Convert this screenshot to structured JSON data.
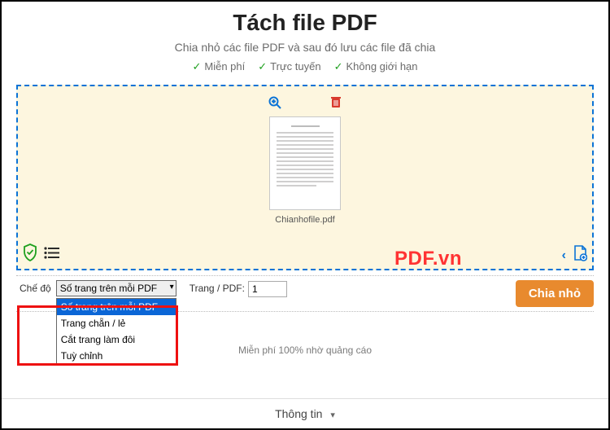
{
  "hero": {
    "title": "Tách file PDF",
    "subtitle": "Chia nhỏ các file PDF và sau đó lưu các file đã chia",
    "features": [
      "Miễn phí",
      "Trực tuyến",
      "Không giới hạn"
    ]
  },
  "file": {
    "name": "Chianhofile.pdf"
  },
  "controls": {
    "mode_label": "Chế độ",
    "mode_selected": "Số trang trên mỗi PDF",
    "mode_options": [
      "Số trang trên mỗi PDF",
      "Trang chẵn / lẻ",
      "Cắt trang làm đôi",
      "Tuỳ chỉnh"
    ],
    "pages_label": "Trang / PDF:",
    "pages_value": "1",
    "split_button": "Chia nhỏ"
  },
  "ad_note": "Miễn phí 100% nhờ quảng cáo",
  "info": {
    "label": "Thông tin"
  },
  "watermark": "PDF.vn"
}
